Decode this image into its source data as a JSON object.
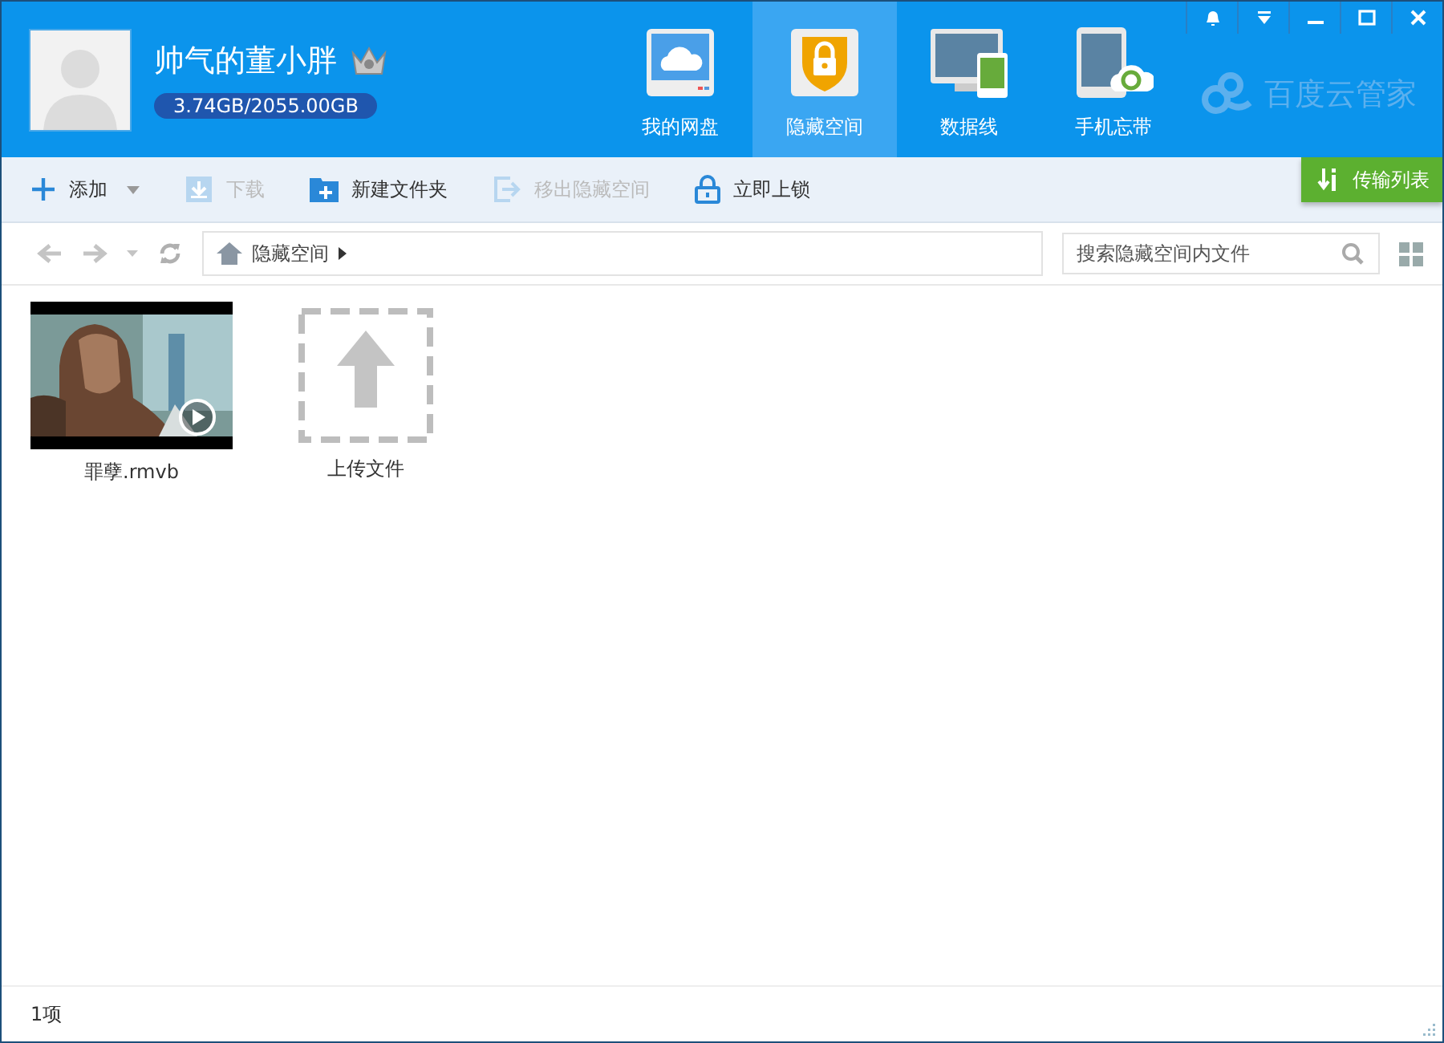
{
  "user": {
    "name": "帅气的董小胖",
    "quota": "3.74GB/2055.00GB"
  },
  "nav_tabs": [
    {
      "label": "我的网盘",
      "kind": "cloud",
      "selected": false
    },
    {
      "label": "隐藏空间",
      "kind": "lock",
      "selected": true
    },
    {
      "label": "数据线",
      "kind": "devices",
      "selected": false
    },
    {
      "label": "手机忘带",
      "kind": "phone",
      "selected": false
    }
  ],
  "brand": "百度云管家",
  "toolbar": [
    {
      "label": "添加",
      "kind": "add",
      "disabled": false,
      "dropdown": true
    },
    {
      "label": "下载",
      "kind": "download",
      "disabled": true,
      "dropdown": false
    },
    {
      "label": "新建文件夹",
      "kind": "folder",
      "disabled": false,
      "dropdown": false
    },
    {
      "label": "移出隐藏空间",
      "kind": "moveout",
      "disabled": true,
      "dropdown": false
    },
    {
      "label": "立即上锁",
      "kind": "lock",
      "disabled": false,
      "dropdown": false
    }
  ],
  "transfer_button": "传输列表",
  "breadcrumb": [
    "隐藏空间"
  ],
  "search": {
    "placeholder": "搜索隐藏空间内文件"
  },
  "files": [
    {
      "name": "罪孽.rmvb",
      "kind": "video"
    },
    {
      "name": "上传文件",
      "kind": "upload"
    }
  ],
  "status_bar": "1项"
}
